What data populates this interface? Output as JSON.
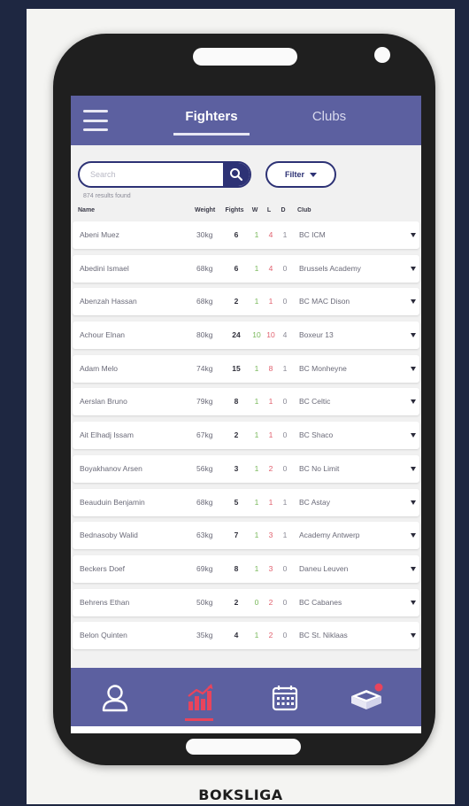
{
  "header": {
    "tabs": [
      {
        "label": "Fighters",
        "active": true
      },
      {
        "label": "Clubs",
        "active": false
      }
    ]
  },
  "search": {
    "placeholder": "Search",
    "filter_label": "Filter",
    "results_text": "874 results found"
  },
  "table": {
    "columns": {
      "name": "Name",
      "weight": "Weight",
      "fights": "Fights",
      "w": "W",
      "l": "L",
      "d": "D",
      "club": "Club"
    },
    "rows": [
      {
        "name": "Abeni Muez",
        "weight": "30kg",
        "fights": "6",
        "w": "1",
        "l": "4",
        "d": "1",
        "club": "BC ICM"
      },
      {
        "name": "Abedini Ismael",
        "weight": "68kg",
        "fights": "6",
        "w": "1",
        "l": "4",
        "d": "0",
        "club": "Brussels Academy"
      },
      {
        "name": "Abenzah Hassan",
        "weight": "68kg",
        "fights": "2",
        "w": "1",
        "l": "1",
        "d": "0",
        "club": "BC MAC Dison"
      },
      {
        "name": "Achour Elnan",
        "weight": "80kg",
        "fights": "24",
        "w": "10",
        "l": "10",
        "d": "4",
        "club": "Boxeur 13"
      },
      {
        "name": "Adam Melo",
        "weight": "74kg",
        "fights": "15",
        "w": "1",
        "l": "8",
        "d": "1",
        "club": "BC Monheyne"
      },
      {
        "name": "Aerslan Bruno",
        "weight": "79kg",
        "fights": "8",
        "w": "1",
        "l": "1",
        "d": "0",
        "club": "BC Celtic"
      },
      {
        "name": "Ait Elhadj Issam",
        "weight": "67kg",
        "fights": "2",
        "w": "1",
        "l": "1",
        "d": "0",
        "club": "BC Shaco"
      },
      {
        "name": "Boyakhanov Arsen",
        "weight": "56kg",
        "fights": "3",
        "w": "1",
        "l": "2",
        "d": "0",
        "club": "BC No Limit"
      },
      {
        "name": "Beauduin Benjamin",
        "weight": "68kg",
        "fights": "5",
        "w": "1",
        "l": "1",
        "d": "1",
        "club": "BC Astay"
      },
      {
        "name": "Bednasoby Walid",
        "weight": "63kg",
        "fights": "7",
        "w": "1",
        "l": "3",
        "d": "1",
        "club": "Academy Antwerp"
      },
      {
        "name": "Beckers Doef",
        "weight": "69kg",
        "fights": "8",
        "w": "1",
        "l": "3",
        "d": "0",
        "club": "Daneu Leuven"
      },
      {
        "name": "Behrens Ethan",
        "weight": "50kg",
        "fights": "2",
        "w": "0",
        "l": "2",
        "d": "0",
        "club": "BC Cabanes"
      },
      {
        "name": "Belon Quinten",
        "weight": "35kg",
        "fights": "4",
        "w": "1",
        "l": "2",
        "d": "0",
        "club": "BC St. Niklaas"
      }
    ]
  },
  "nav": {
    "items": [
      {
        "icon": "person-icon",
        "active": false
      },
      {
        "icon": "stats-chart-icon",
        "active": true
      },
      {
        "icon": "calendar-icon",
        "active": false
      },
      {
        "icon": "boxing-ring-icon",
        "active": false,
        "notification": true
      }
    ]
  },
  "colors": {
    "primary": "#5c60a0",
    "accent": "#e8445c",
    "win": "#78b85a",
    "loss": "#e1606e",
    "search_border": "#2d3275"
  },
  "brand": {
    "name": "BOKSLIGA"
  }
}
